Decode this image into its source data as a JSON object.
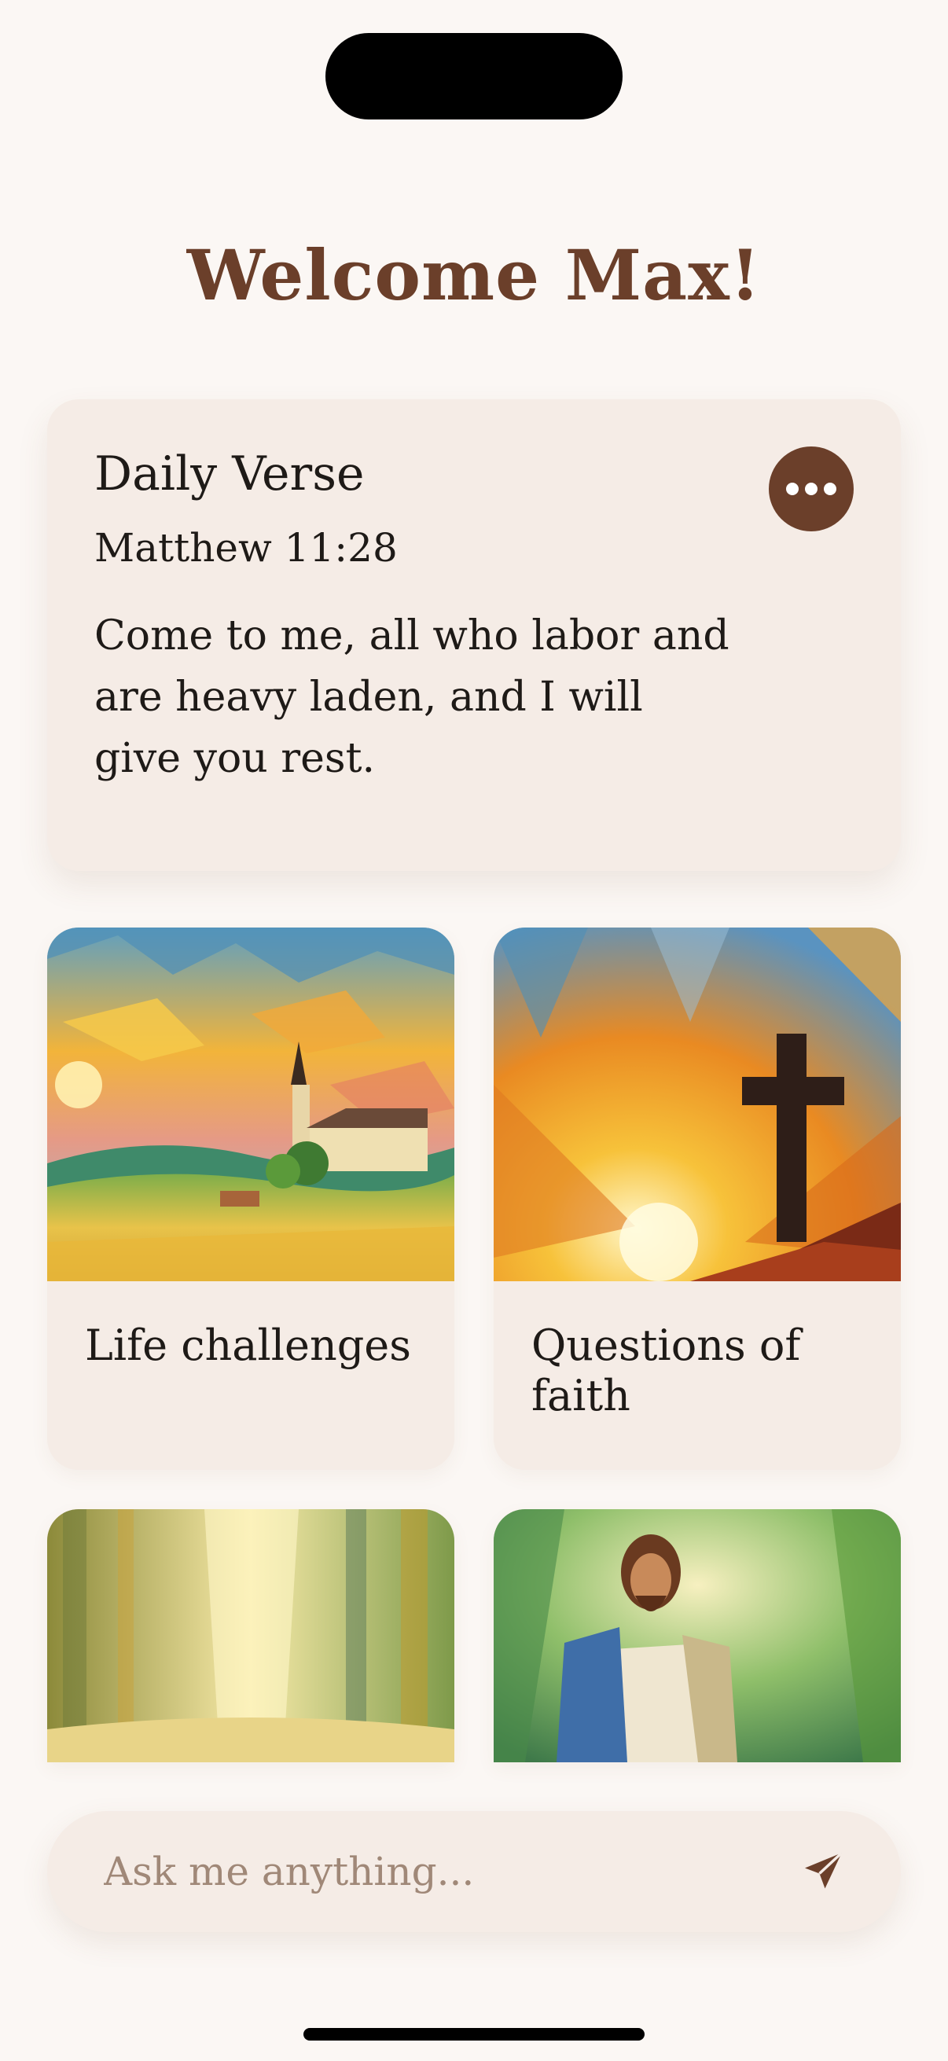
{
  "header": {
    "welcome_text": "Welcome Max!"
  },
  "daily_verse": {
    "title": "Daily Verse",
    "reference": "Matthew 11:28",
    "text": "Come to me, all who labor and are heavy laden, and I will give you rest."
  },
  "topics": [
    {
      "label": "Life challenges",
      "icon": "church-landscape-painting"
    },
    {
      "label": "Questions of faith",
      "icon": "cross-sunset-painting"
    },
    {
      "label": "",
      "icon": "forest-light-painting"
    },
    {
      "label": "",
      "icon": "jesus-painting"
    }
  ],
  "ask": {
    "placeholder": "Ask me anything...",
    "send_icon": "send-icon"
  },
  "colors": {
    "background": "#fbf7f4",
    "card": "#f5ece6",
    "accent_brown": "#6b3f2a"
  }
}
